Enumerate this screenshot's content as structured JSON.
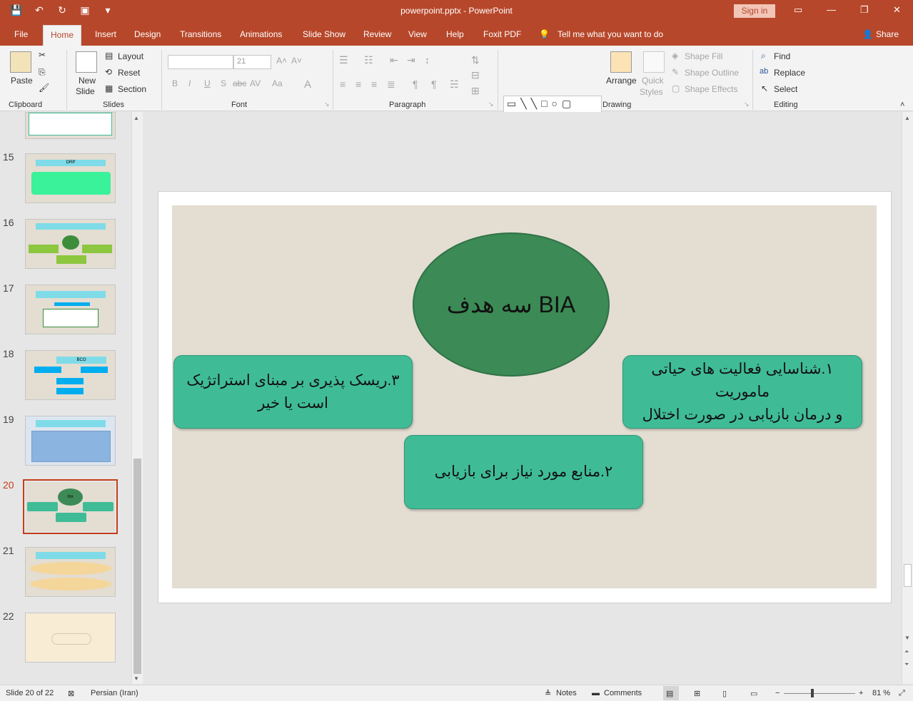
{
  "window": {
    "title": "powerpoint.pptx  -  PowerPoint",
    "sign_in": "Sign in",
    "min_icon": "—",
    "max_icon": "❐",
    "close_icon": "✕"
  },
  "tabs": [
    "File",
    "Home",
    "Insert",
    "Design",
    "Transitions",
    "Animations",
    "Slide Show",
    "Review",
    "View",
    "Help",
    "Foxit PDF"
  ],
  "tell_me": "Tell me what you want to do",
  "share": "Share",
  "ribbon": {
    "clipboard": {
      "paste": "Paste",
      "label": "Clipboard"
    },
    "slides": {
      "new_slide_1": "New",
      "new_slide_2": "Slide",
      "layout": "Layout",
      "reset": "Reset",
      "section": "Section",
      "label": "Slides"
    },
    "font": {
      "size": "21",
      "label": "Font",
      "b": "B",
      "i": "I",
      "u": "U",
      "s": "S",
      "abc": "abc",
      "av": "AV",
      "aa": "Aa",
      "a": "A"
    },
    "paragraph": {
      "label": "Paragraph"
    },
    "drawing": {
      "arrange": "Arrange",
      "quick_1": "Quick",
      "quick_2": "Styles",
      "shape_fill": "Shape Fill",
      "shape_outline": "Shape Outline",
      "shape_effects": "Shape Effects",
      "label": "Drawing"
    },
    "editing": {
      "find": "Find",
      "replace": "Replace",
      "select": "Select",
      "label": "Editing"
    }
  },
  "thumbnails": [
    {
      "number": "15",
      "caption": "DRP"
    },
    {
      "number": "16",
      "caption": ""
    },
    {
      "number": "17",
      "caption": ""
    },
    {
      "number": "18",
      "caption": "BCO"
    },
    {
      "number": "19",
      "caption": ""
    },
    {
      "number": "20",
      "caption": "BIA"
    },
    {
      "number": "21",
      "caption": ""
    },
    {
      "number": "22",
      "caption": ""
    }
  ],
  "slide": {
    "center_title": "سه هدف BIA",
    "box_right": "۱.شناسایی فعالیت های حیاتی ماموریت\nو درمان بازیابی در صورت اختلال",
    "box_left": "۳.ریسک پذیری بر مبنای استراتژیک\nاست یا خیر",
    "box_bottom": "۲.منابع مورد نیاز برای بازیابی"
  },
  "status": {
    "slide_info": "Slide 20 of 22",
    "language": "Persian (Iran)",
    "notes": "Notes",
    "comments": "Comments",
    "zoom": "81 %"
  },
  "colors": {
    "brand": "#b7472a",
    "slide_bg": "#e3ddd2",
    "ellipse": "#3c8a55",
    "box": "#3fbc96"
  }
}
